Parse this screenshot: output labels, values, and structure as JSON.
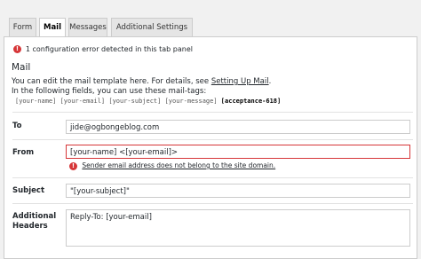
{
  "tabs": [
    {
      "label": "Form"
    },
    {
      "label": "Mail"
    },
    {
      "label": "Messages"
    },
    {
      "label": "Additional Settings (1)"
    }
  ],
  "notice": {
    "text": "1 configuration error detected in this tab panel"
  },
  "section": {
    "title": "Mail",
    "desc_prefix": "You can edit the mail template here. For details, see ",
    "desc_link": "Setting Up Mail",
    "desc_suffix": ".",
    "desc_line2": "In the following fields, you can use these mail-tags:",
    "tags": "[your-name] [your-email] [your-subject] [your-message]",
    "tag_bold": "[acceptance-618]"
  },
  "fields": {
    "to": {
      "label": "To",
      "value": "jide@ogbongeblog.com"
    },
    "from": {
      "label": "From",
      "value": "[your-name] <[your-email]>",
      "error": "Sender email address does not belong to the site domain."
    },
    "subject": {
      "label": "Subject",
      "value": "\"[your-subject]\""
    },
    "headers": {
      "label_line1": "Additional",
      "label_line2": "Headers",
      "value": "Reply-To: [your-email]"
    }
  },
  "colors": {
    "error": "#d63638",
    "link": "#0073aa"
  }
}
